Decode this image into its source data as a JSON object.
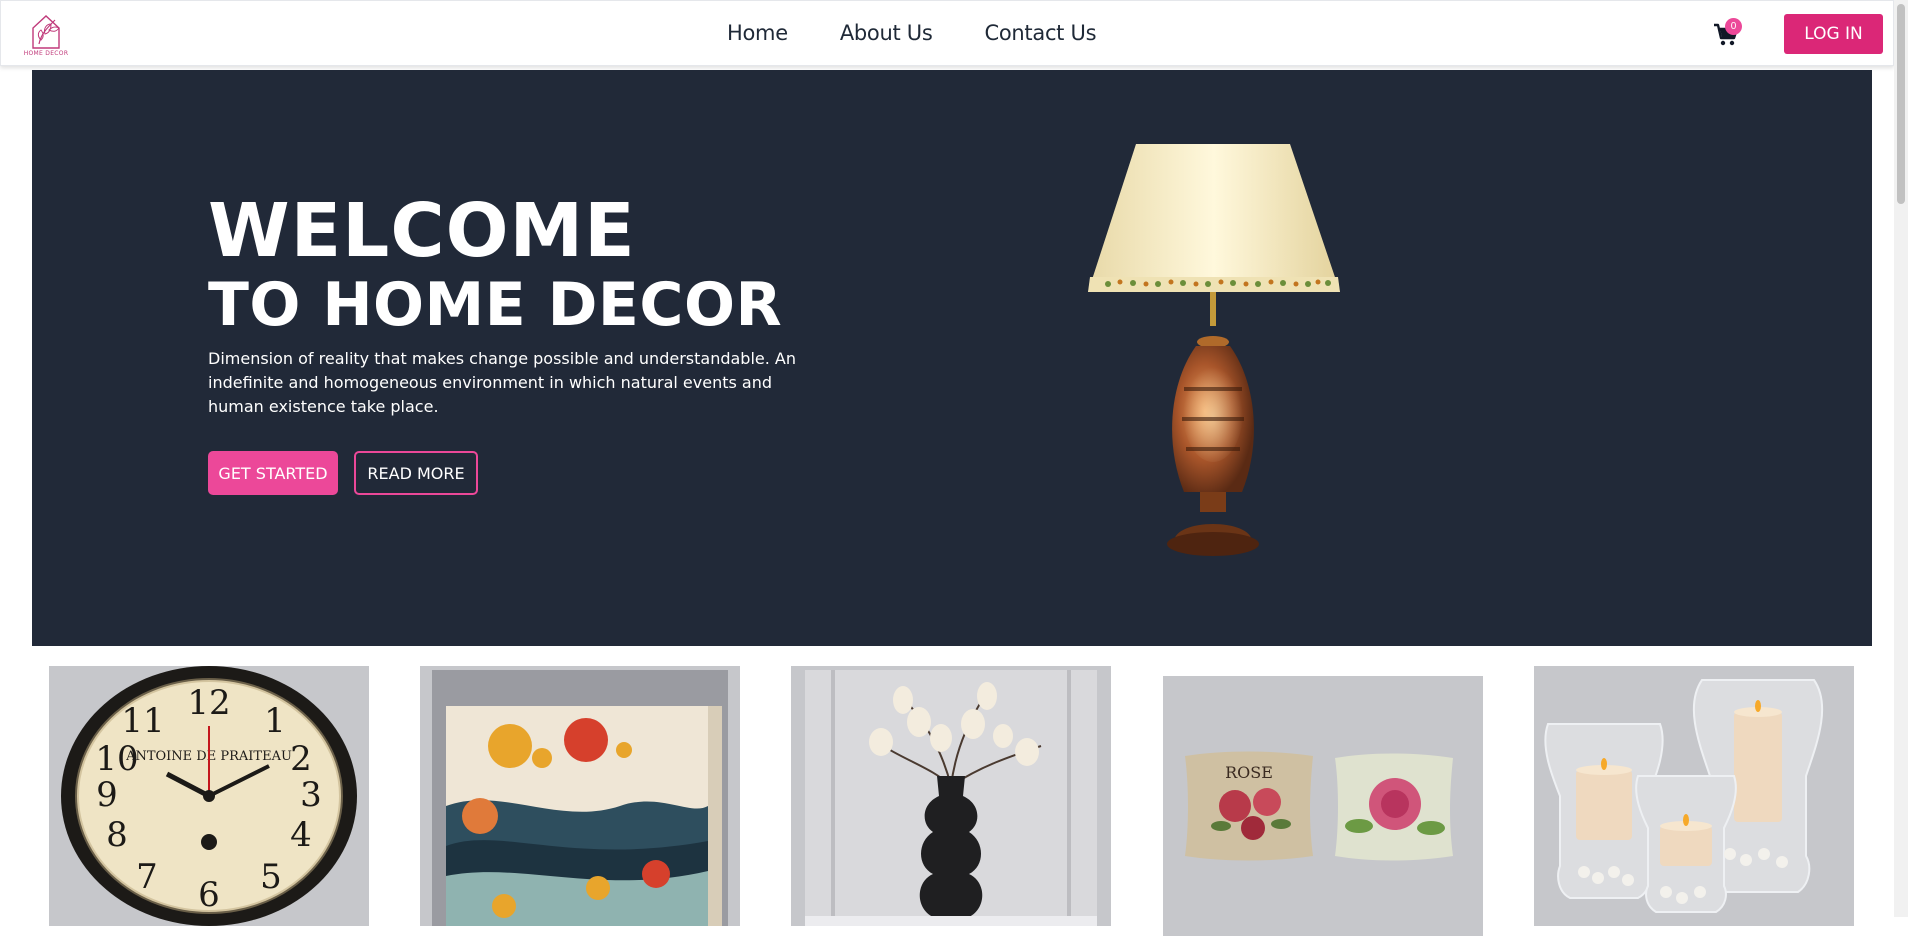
{
  "navbar": {
    "logo_text": "HOME DECOR",
    "links": [
      {
        "label": "Home"
      },
      {
        "label": "About Us"
      },
      {
        "label": "Contact Us"
      }
    ],
    "cart_count": "0",
    "login_label": "LOG IN"
  },
  "hero": {
    "title_line1": "WELCOME",
    "title_line2": "TO HOME DECOR",
    "description": "Dimension of reality that makes change possible and understandable. An indefinite and homogeneous environment in which natural events and human existence take place.",
    "primary_button": "GET STARTED",
    "secondary_button": "READ MORE",
    "background_color": "#212938",
    "accent_color": "#ec4899"
  },
  "products": [
    {
      "name": "wall-clock-image",
      "clock_text": "ANTOINE DE PRAITEAU"
    },
    {
      "name": "abstract-canvas-art-image"
    },
    {
      "name": "flower-vase-image"
    },
    {
      "name": "rose-cushions-image",
      "cushion_text": "ROSE"
    },
    {
      "name": "glass-candle-holders-image"
    }
  ]
}
